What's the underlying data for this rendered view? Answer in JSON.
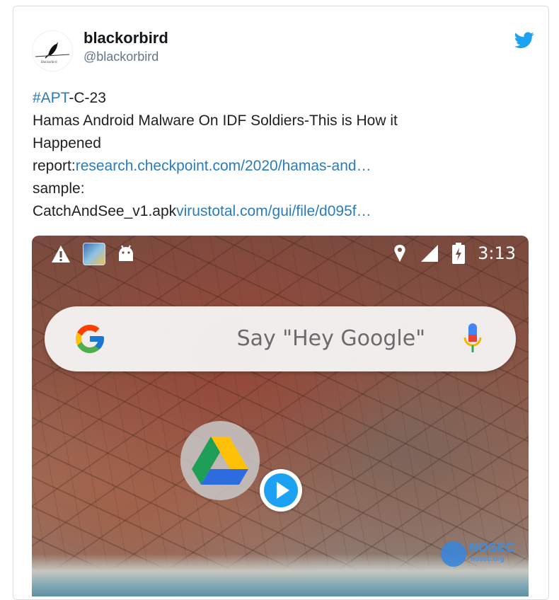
{
  "tweet": {
    "author": {
      "display_name": "blackorbird",
      "handle": "@blackorbird",
      "avatar_icon": "bird-on-wire-avatar"
    },
    "platform_icon": "twitter-bird-icon",
    "platform_color": "#1da1f2",
    "link_color": "#2b7bb9",
    "lines": {
      "hashtag": "#APT",
      "hashtag_rest": "-C-23",
      "title_1": "Hamas Android Malware On IDF Soldiers-This is How it",
      "title_2": "Happened",
      "report_label": "report:",
      "report_link": "research.checkpoint.com/2020/hamas-and…",
      "sample_label": "sample:",
      "sample_file": "CatchAndSee_v1.apk",
      "sample_link": "virustotal.com/gui/file/d095f…"
    }
  },
  "media": {
    "type": "video",
    "status_bar": {
      "icons_left": [
        "warning-icon",
        "app-thumbnail-icon",
        "android-icon"
      ],
      "icons_right": [
        "location-icon",
        "signal-icon",
        "battery-charging-icon"
      ],
      "time": "3:13"
    },
    "search_bar": {
      "logo": "google-g-icon",
      "placeholder": "Say \"Hey Google\"",
      "mic": "microphone-icon"
    },
    "app_icon": "google-drive-icon",
    "play_button": "play-icon",
    "watermark": {
      "text": "NOSEC",
      "subtext": "nosec.org"
    }
  }
}
